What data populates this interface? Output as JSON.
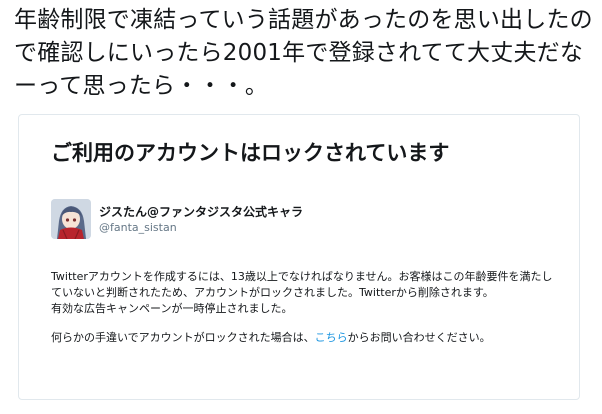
{
  "tweet": {
    "text": "年齢制限で凍結っていう話題があったのを思い出したので確認しにいったら2001年で登録されてて大丈夫だなーって思ったら・・・。"
  },
  "card": {
    "title": "ご利用のアカウントはロックされています",
    "account": {
      "display_name": "ジスたん@ファンタジスタ公式キャラ",
      "handle": "@fanta_sistan",
      "avatar_icon": "character-avatar-icon"
    },
    "notice": {
      "line1": "Twitterアカウントを作成するには、13歳以上でなければなりません。お客様はこの年齢要件を満たしていないと判断されたため、アカウントがロックされました。Twitterから削除されます。",
      "line2": "有効な広告キャンペーンが一時停止されました。",
      "line3_prefix": "何らかの手違いでアカウントがロックされた場合は、",
      "line3_link": "こちら",
      "line3_suffix": "からお問い合わせください。"
    }
  },
  "colors": {
    "link": "#1b95e0",
    "secondary_text": "#657786",
    "card_border": "#e1e8ed"
  }
}
